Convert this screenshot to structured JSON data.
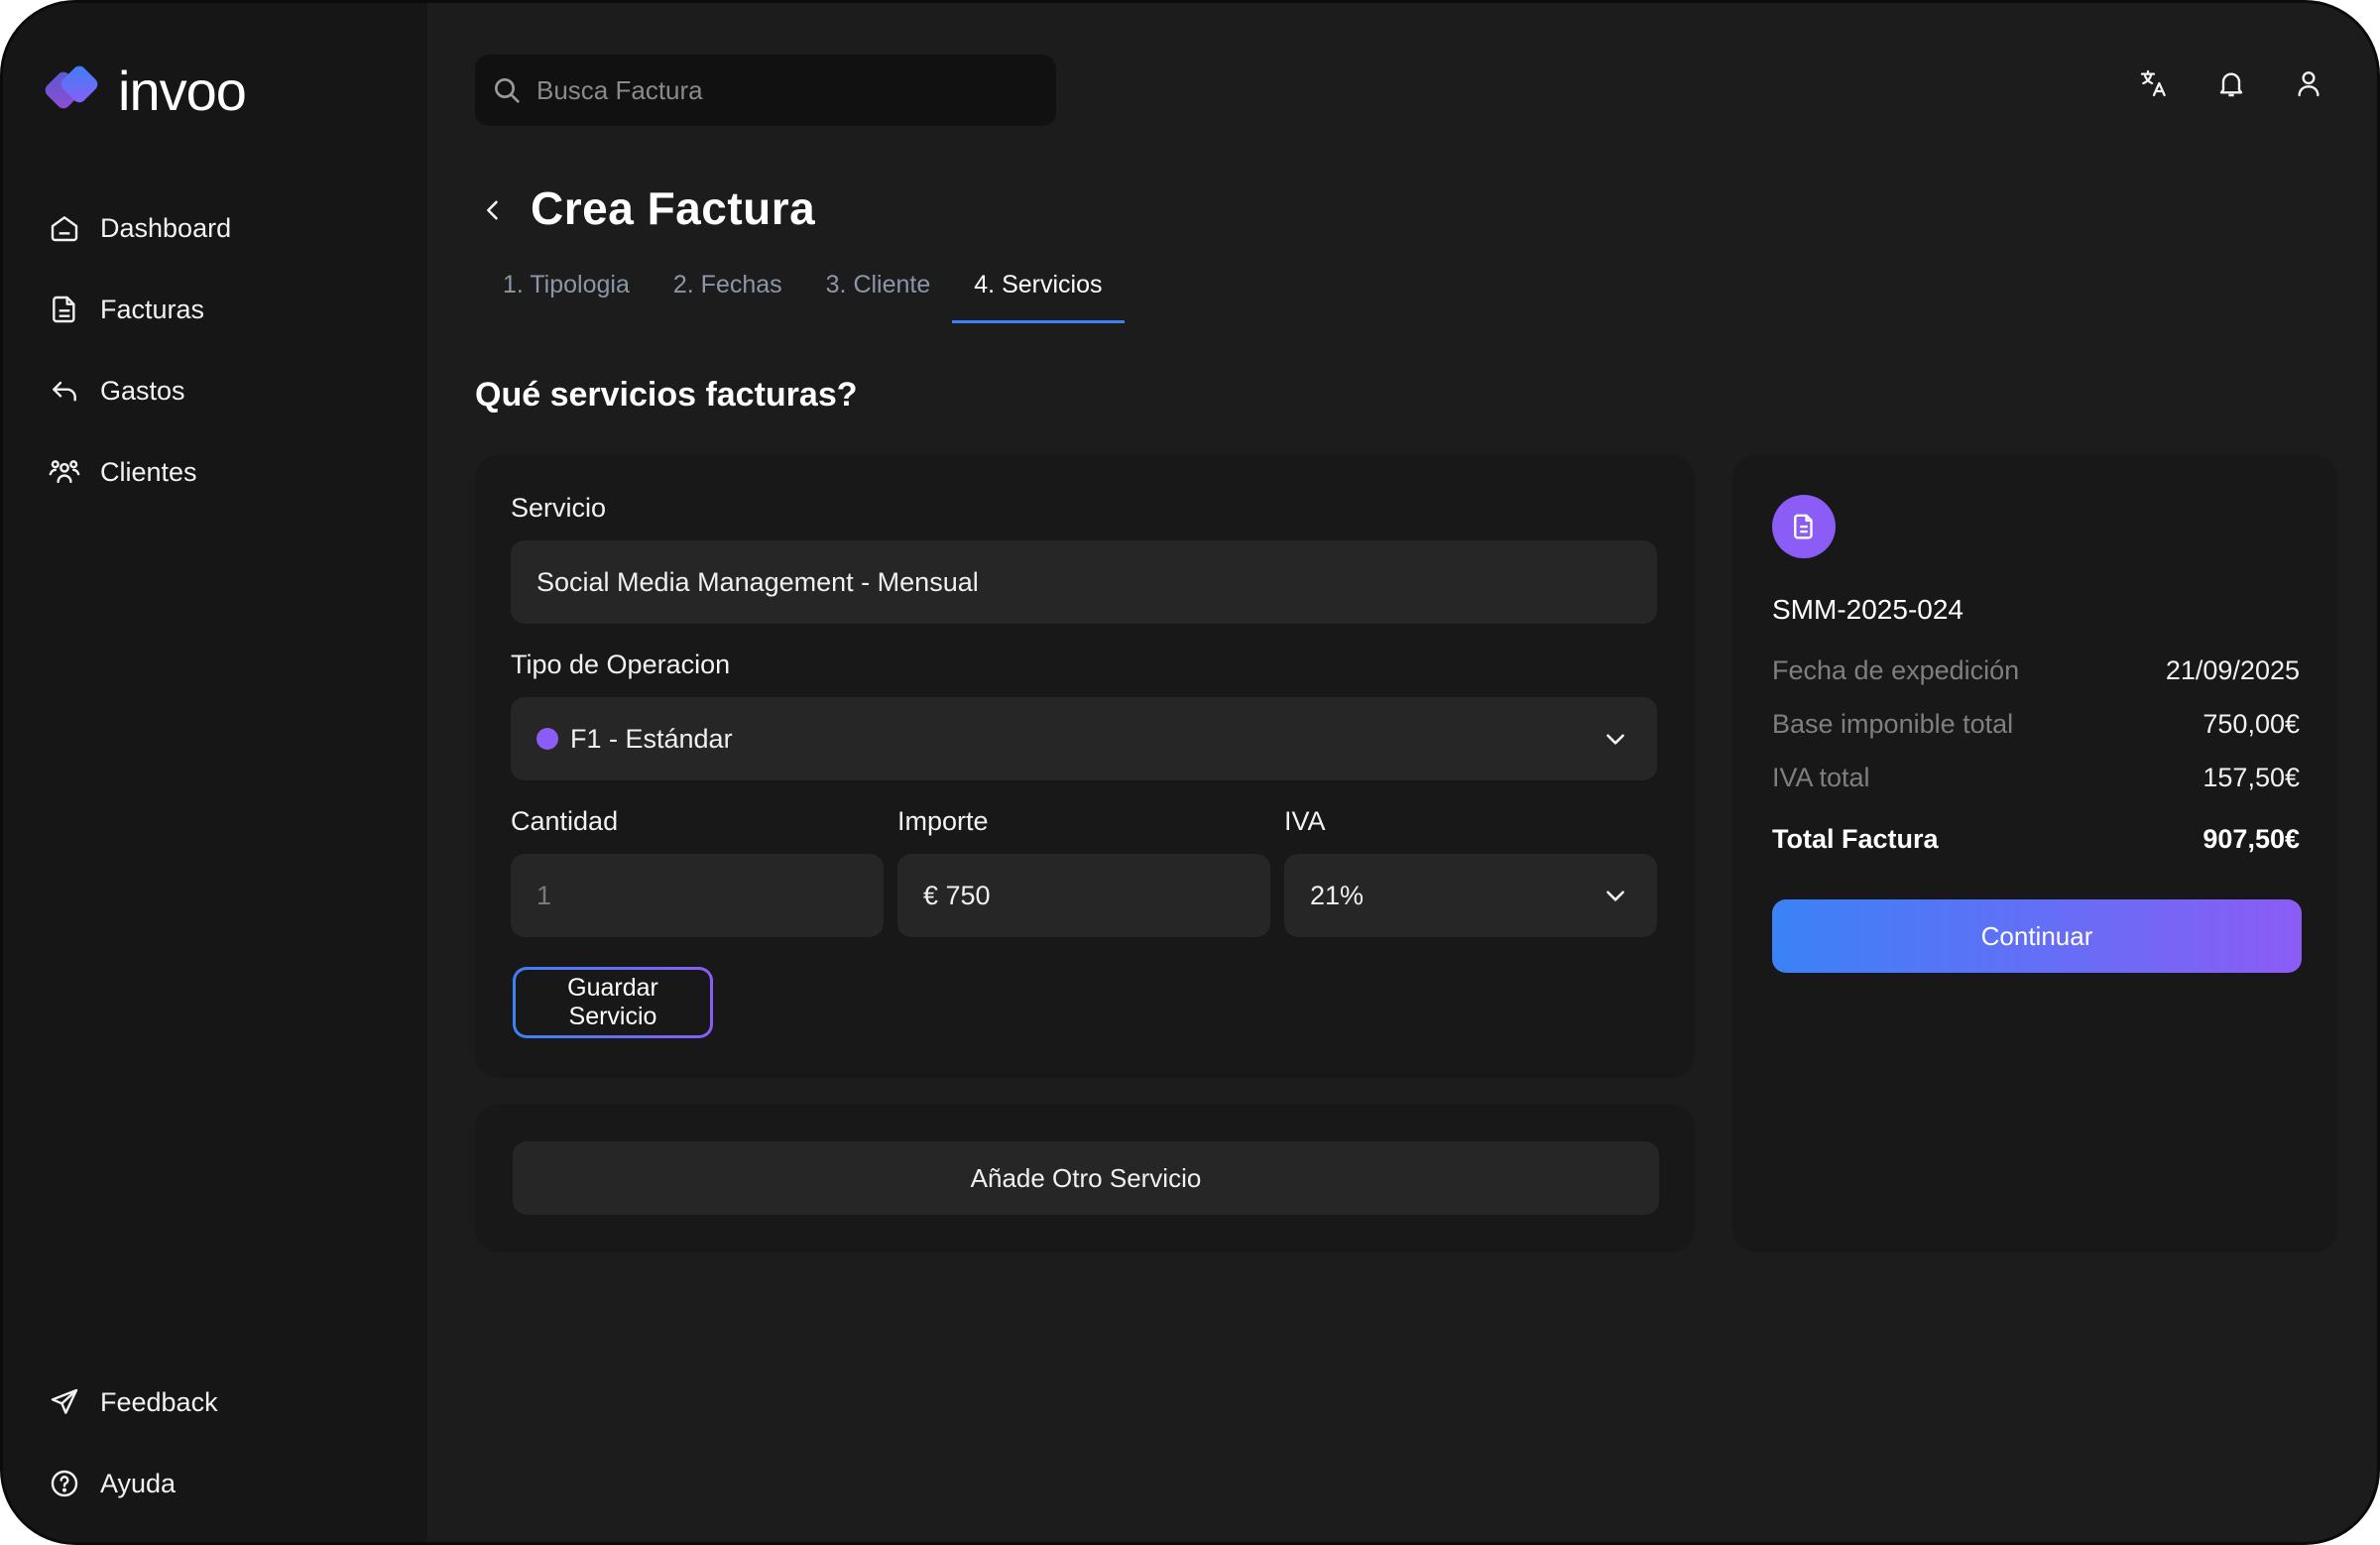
{
  "app": {
    "name": "invoo"
  },
  "colors": {
    "accent_blue": "#3b82f6",
    "accent_purple": "#8b5cf6",
    "badge_purple": "#8b5cf6",
    "operation_dot": "#8b5cf6"
  },
  "sidebar": {
    "items": [
      {
        "label": "Dashboard",
        "icon": "home-icon"
      },
      {
        "label": "Facturas",
        "icon": "document-icon"
      },
      {
        "label": "Gastos",
        "icon": "undo-arrow-icon"
      },
      {
        "label": "Clientes",
        "icon": "users-icon"
      }
    ],
    "bottom_items": [
      {
        "label": "Feedback",
        "icon": "send-icon"
      },
      {
        "label": "Ayuda",
        "icon": "help-circle-icon"
      }
    ]
  },
  "search": {
    "placeholder": "Busca Factura"
  },
  "header_icons": [
    "translate-icon",
    "bell-icon",
    "user-icon"
  ],
  "page": {
    "title": "Crea Factura",
    "tabs": [
      {
        "label": "1. Tipologia",
        "active": false
      },
      {
        "label": "2. Fechas",
        "active": false
      },
      {
        "label": "3. Cliente",
        "active": false
      },
      {
        "label": "4. Servicios",
        "active": true
      }
    ],
    "section_title": "Qué servicios facturas?"
  },
  "form": {
    "servicio_label": "Servicio",
    "servicio_value": "Social Media Management - Mensual",
    "operacion_label": "Tipo de Operacion",
    "operacion_value": "F1 - Estándar",
    "cantidad_label": "Cantidad",
    "cantidad_placeholder": "1",
    "importe_label": "Importe",
    "importe_value": "€ 750",
    "iva_label": "IVA",
    "iva_value": "21%",
    "save_button": "Guardar Servicio",
    "add_button": "Añade Otro Servicio"
  },
  "summary": {
    "invoice_number": "SMM-2025-024",
    "rows": [
      {
        "label": "Fecha de expedición",
        "value": "21/09/2025"
      },
      {
        "label": "Base imponible total",
        "value": "750,00€"
      },
      {
        "label": "IVA total",
        "value": "157,50€"
      }
    ],
    "total_label": "Total Factura",
    "total_value": "907,50€",
    "continue_button": "Continuar"
  }
}
